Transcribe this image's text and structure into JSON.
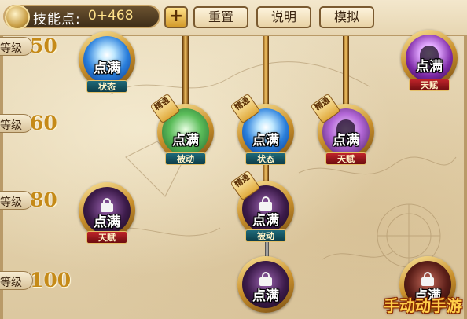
{
  "topbar": {
    "skill_points_label": "技能点:",
    "skill_points_value": "0+468",
    "add_label": "+",
    "reset_label": "重置",
    "info_label": "说明",
    "simulate_label": "模拟"
  },
  "levels": [
    {
      "label": "等级",
      "value": "50"
    },
    {
      "label": "等级",
      "value": "60"
    },
    {
      "label": "等级",
      "value": "80"
    },
    {
      "label": "等级",
      "value": "100"
    }
  ],
  "nodes": {
    "r1_left": {
      "text": "点满",
      "tag": "状态"
    },
    "r1_right": {
      "text": "点满",
      "tag": "天赋"
    },
    "r2_left": {
      "text": "点满",
      "tag": "被动",
      "badge": "精通"
    },
    "r2_mid": {
      "text": "点满",
      "tag": "状态",
      "badge": "精通"
    },
    "r2_right": {
      "text": "点满",
      "tag": "天赋",
      "badge": "精通"
    },
    "r3_left": {
      "text": "点满",
      "tag": "天赋"
    },
    "r3_mid": {
      "text": "点满",
      "tag": "被动",
      "badge": "精通"
    },
    "r4_mid": {
      "text": "点满"
    },
    "r4_right": {
      "text": "点满"
    }
  },
  "watermark": "手动动手游",
  "colors": {
    "accent_gold": "#c58a18",
    "state_tag": "#1f6a7a",
    "talent_tag": "#c0242a",
    "watermark": "#ffcf4a"
  }
}
